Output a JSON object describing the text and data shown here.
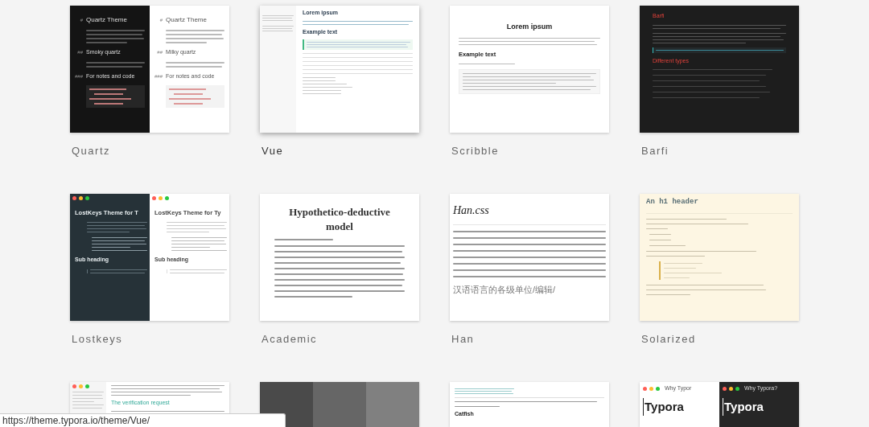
{
  "themes": [
    {
      "name": "Quartz",
      "selected": false,
      "thumb": {
        "kind": "quartz",
        "panes": [
          {
            "kind": "dark",
            "headings": [
              {
                "marker": "#",
                "text": "Quartz Theme"
              },
              {
                "marker": "##",
                "text": "Smoky quartz"
              },
              {
                "marker": "###",
                "text": "For notes and code"
              }
            ]
          },
          {
            "kind": "light",
            "headings": [
              {
                "marker": "#",
                "text": "Quartz Theme"
              },
              {
                "marker": "##",
                "text": "Milky quartz"
              },
              {
                "marker": "###",
                "text": "For notes and code"
              }
            ]
          }
        ]
      }
    },
    {
      "name": "Vue",
      "selected": true,
      "thumb": {
        "kind": "vue",
        "title": "Lorem ipsum",
        "subtitle": "Example text"
      }
    },
    {
      "name": "Scribble",
      "selected": false,
      "thumb": {
        "kind": "scribble",
        "title": "Lorem ipsum",
        "subtitle": "Example text"
      }
    },
    {
      "name": "Barfi",
      "selected": false,
      "thumb": {
        "kind": "barfi",
        "title": "Barfi",
        "subtitle": "Different types"
      }
    },
    {
      "name": "Lostkeys",
      "selected": false,
      "thumb": {
        "kind": "lostkeys",
        "panes": [
          {
            "kind": "dark",
            "title": "LostKeys Theme for T",
            "subtitle": "Sub heading"
          },
          {
            "kind": "light",
            "title": "LostKeys Theme for Ty",
            "subtitle": "Sub heading"
          }
        ]
      }
    },
    {
      "name": "Academic",
      "selected": false,
      "thumb": {
        "kind": "academic",
        "title": "Hypothetico-deductive model"
      }
    },
    {
      "name": "Han",
      "selected": false,
      "thumb": {
        "kind": "han",
        "title": "Han.css",
        "subtitle": "汉语语言的各级单位/编辑/"
      }
    },
    {
      "name": "Solarized",
      "selected": false,
      "thumb": {
        "kind": "solarized",
        "title": "An h1 header"
      }
    },
    {
      "selected": false,
      "thumb": {
        "kind": "article",
        "subtitle": "The verification request"
      }
    },
    {
      "selected": false,
      "thumb": {
        "kind": "stripes"
      }
    },
    {
      "selected": false,
      "thumb": {
        "kind": "catfish",
        "title": "Catfish"
      }
    },
    {
      "selected": false,
      "thumb": {
        "kind": "typora",
        "panes": [
          {
            "kind": "light",
            "caption": "Why Typor",
            "title": "Typora"
          },
          {
            "kind": "dark",
            "caption": "Why Typora?",
            "title": "Typora"
          }
        ]
      }
    }
  ],
  "status_bar": {
    "url": "https://theme.typora.io/theme/Vue/"
  }
}
